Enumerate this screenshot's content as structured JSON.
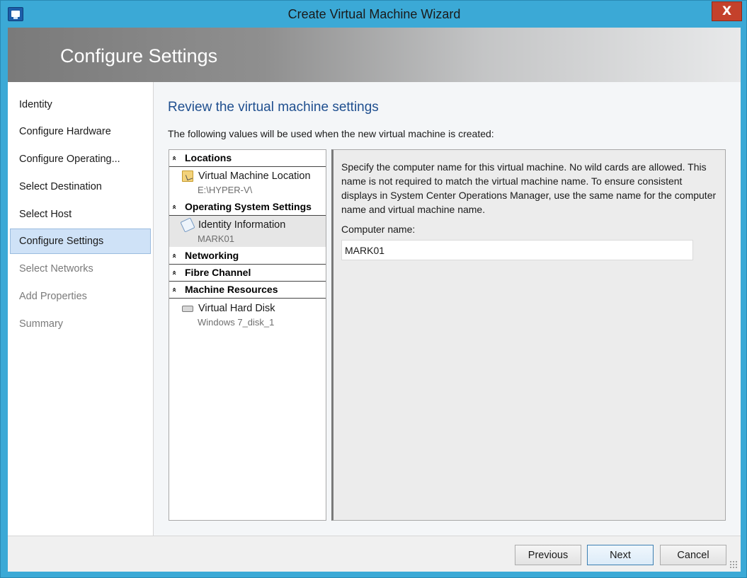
{
  "window": {
    "title": "Create Virtual Machine Wizard",
    "close_label": "X"
  },
  "banner": {
    "title": "Configure Settings"
  },
  "nav": {
    "items": [
      {
        "label": "Identity",
        "state": "normal"
      },
      {
        "label": "Configure Hardware",
        "state": "normal"
      },
      {
        "label": "Configure Operating...",
        "state": "normal"
      },
      {
        "label": "Select Destination",
        "state": "normal"
      },
      {
        "label": "Select Host",
        "state": "normal"
      },
      {
        "label": "Configure Settings",
        "state": "active"
      },
      {
        "label": "Select Networks",
        "state": "disabled"
      },
      {
        "label": "Add Properties",
        "state": "disabled"
      },
      {
        "label": "Summary",
        "state": "disabled"
      }
    ]
  },
  "main": {
    "heading": "Review the virtual machine settings",
    "description": "The following values will be used when the new virtual machine is created:"
  },
  "settings": {
    "groups": [
      {
        "label": "Locations",
        "chevron": "«"
      },
      {
        "label": "Operating System Settings",
        "chevron": "«"
      },
      {
        "label": "Networking",
        "chevron": "«"
      },
      {
        "label": "Fibre Channel",
        "chevron": "«"
      },
      {
        "label": "Machine Resources",
        "chevron": "«"
      }
    ],
    "items": [
      {
        "title": "Virtual Machine Location",
        "subtitle": "E:\\HYPER-V\\",
        "icon": "folder-icon"
      },
      {
        "title": "Identity Information",
        "subtitle": "MARK01",
        "icon": "identity-icon"
      },
      {
        "title": "Virtual Hard Disk",
        "subtitle": "Windows 7_disk_1",
        "icon": "hard-disk-icon"
      }
    ]
  },
  "detail": {
    "text": "Specify the computer name for this virtual machine. No wild cards are allowed. This name is not required to match the virtual machine name. To ensure consistent displays in System Center Operations Manager, use the same name for the computer name and virtual machine name.",
    "field_label": "Computer name:",
    "computer_name": "MARK01"
  },
  "footer": {
    "previous_label": "Previous",
    "next_label": "Next",
    "cancel_label": "Cancel"
  },
  "colors": {
    "window_frame": "#3ba9d6",
    "close_button": "#c4412b",
    "heading_blue": "#1f4f8f",
    "nav_active": "#cfe2f7"
  }
}
